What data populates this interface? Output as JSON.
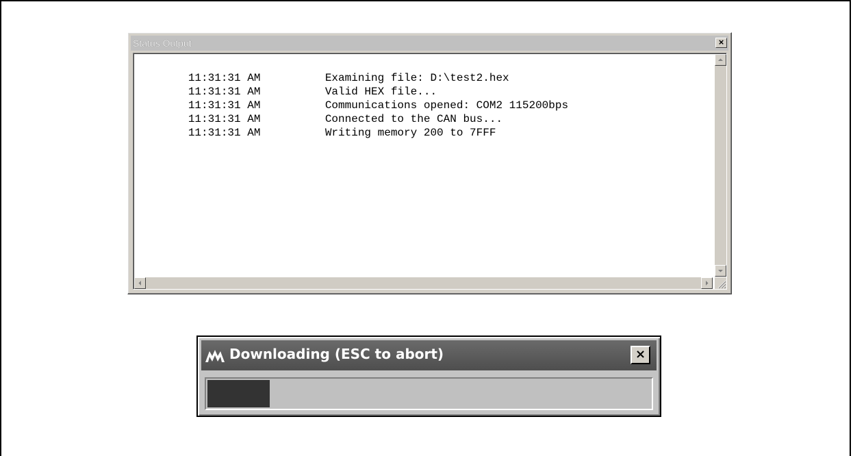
{
  "status_window": {
    "title": "Status Output",
    "close_glyph": "×",
    "log": [
      {
        "time": "11:31:31 AM",
        "message": "Examining file: D:\\test2.hex"
      },
      {
        "time": "11:31:31 AM",
        "message": "Valid HEX file..."
      },
      {
        "time": "11:31:31 AM",
        "message": "Communications opened: COM2 115200bps"
      },
      {
        "time": "11:31:31 AM",
        "message": "Connected to the CAN bus..."
      },
      {
        "time": "11:31:31 AM",
        "message": "Writing memory 200 to 7FFF"
      }
    ],
    "scroll_icons": [
      "scroll-up-icon",
      "scroll-down-icon",
      "scroll-left-icon",
      "scroll-right-icon",
      "size-grip-icon"
    ]
  },
  "download_dialog": {
    "title": "Downloading (ESC to abort)",
    "close_glyph": "×",
    "logo_icon": "microchip-logo-icon",
    "progress_fraction": 0.14,
    "progress_color": "#333333"
  }
}
